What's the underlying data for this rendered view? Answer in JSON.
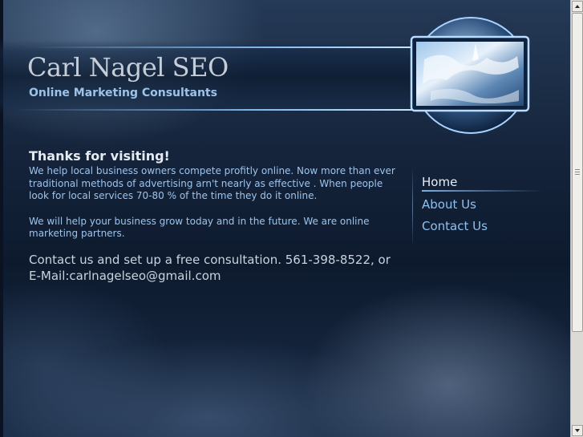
{
  "header": {
    "title": "Carl Nagel SEO",
    "subtitle": "Online Marketing Consultants"
  },
  "content": {
    "heading": "Thanks for visiting!",
    "paragraph1": "We help local business owners compete profitly online. Now more than ever traditional methods of advertising arn't nearly as effective . When people look for local services 70-80 % of the time they do it online.",
    "paragraph2": "We will help your business grow today and in the future. We are online marketing partners.",
    "contact": "Contact us and set up a free consultation.  561-398-8522, or E-Mail:carlnagelseo@gmail.com"
  },
  "nav": {
    "items": [
      {
        "label": "Home",
        "active": true
      },
      {
        "label": "About Us",
        "active": false
      },
      {
        "label": "Contact Us",
        "active": false
      }
    ]
  },
  "colors": {
    "background": "#15243b",
    "accent": "#9ec4ec",
    "title": "#c4cdd8"
  },
  "icons": {
    "hero": "globe-monitor-icon"
  }
}
